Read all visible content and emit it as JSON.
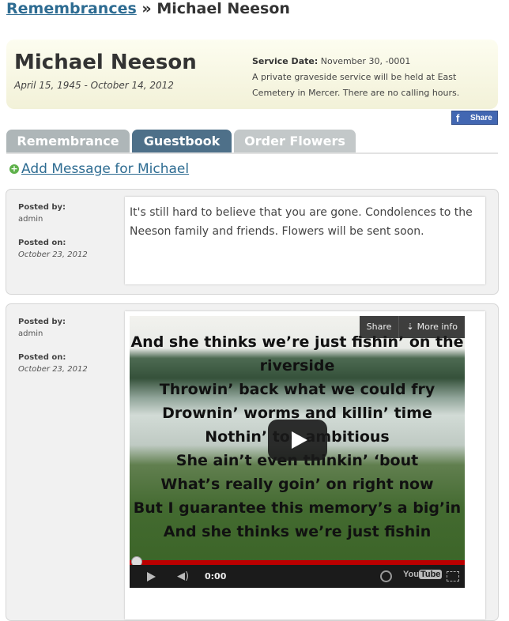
{
  "breadcrumb": {
    "link": "Remembrances",
    "sep": "»",
    "current": "Michael Neeson"
  },
  "obituary": {
    "name": "Michael Neeson",
    "dates": "April 15, 1945 - October 14, 2012",
    "service_label": "Service Date:",
    "service_date": "November 30, -0001",
    "service_note": "A private graveside service will be held at East Cemetery in Mercer. There are no calling hours."
  },
  "share": {
    "label": "Share",
    "icon": "facebook-icon"
  },
  "tabs": [
    {
      "label": "Remembrance",
      "active": false
    },
    {
      "label": "Guestbook",
      "active": true
    },
    {
      "label": "Order Flowers",
      "active": false
    }
  ],
  "add_message": {
    "label": "Add Message for Michael",
    "icon": "plus-circle-icon"
  },
  "posts": [
    {
      "posted_by_label": "Posted by:",
      "posted_by": "admin",
      "posted_on_label": "Posted on:",
      "posted_on": "October 23, 2012",
      "message": "It's still hard to believe that you are gone. Condolences to the Neeson family and friends. Flowers will be sent soon."
    },
    {
      "posted_by_label": "Posted by:",
      "posted_by": "admin",
      "posted_on_label": "Posted on:",
      "posted_on": "October 23, 2012",
      "video": {
        "share_label": "Share",
        "more_info_label": "More info",
        "time": "0:00",
        "progress": 0,
        "logo": "YouTube",
        "lyrics": [
          "And she thinks we’re just fishin’ on the",
          "riverside",
          "Throwin’ back what we could fry",
          "Drownin’ worms and killin’ time",
          "Nothin’ too ambitious",
          "She ain’t even thinkin’ ‘bout",
          "What’s really goin’ on right now",
          "But I guarantee this memory’s a big’in",
          "And she thinks we’re just fishin"
        ]
      }
    }
  ]
}
